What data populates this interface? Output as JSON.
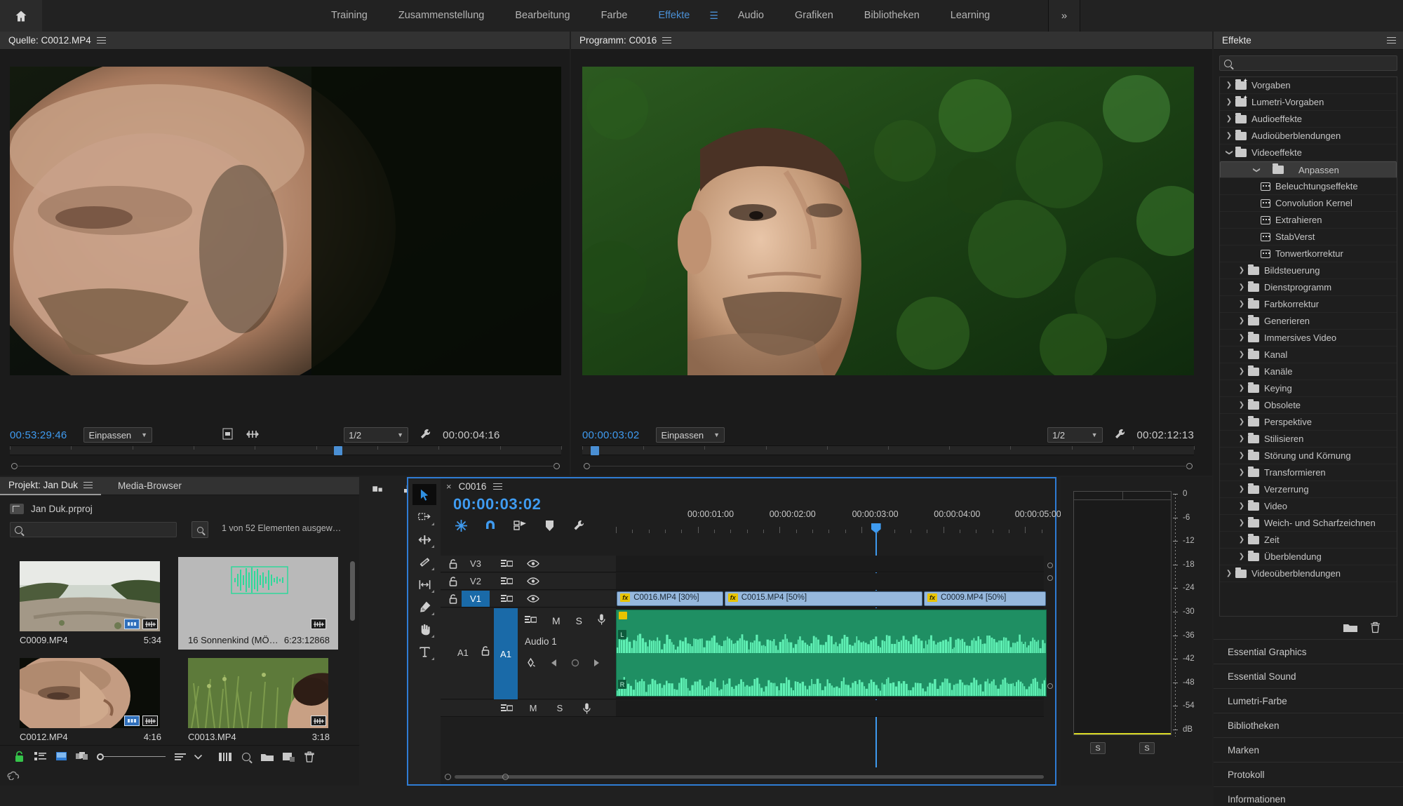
{
  "app": {
    "home_label": "home-icon",
    "overflow_label": "»"
  },
  "workspaces": [
    {
      "label": "Training",
      "active": false
    },
    {
      "label": "Zusammenstellung",
      "active": false
    },
    {
      "label": "Bearbeitung",
      "active": false
    },
    {
      "label": "Farbe",
      "active": false
    },
    {
      "label": "Effekte",
      "active": true
    },
    {
      "label": "Audio",
      "active": false
    },
    {
      "label": "Grafiken",
      "active": false
    },
    {
      "label": "Bibliotheken",
      "active": false
    },
    {
      "label": "Learning",
      "active": false
    }
  ],
  "source_monitor": {
    "tab_label": "Quelle: C0012.MP4",
    "current_time": "00:53:29:46",
    "fit_label": "Einpassen",
    "resolution_label": "1/2",
    "duration": "00:00:04:16",
    "playhead_pct": 59.5
  },
  "program_monitor": {
    "tab_label": "Programm: C0016",
    "current_time": "00:00:03:02",
    "fit_label": "Einpassen",
    "resolution_label": "1/2",
    "duration": "00:02:12:13",
    "playhead_pct": 1.4
  },
  "project_panel": {
    "tabs": [
      {
        "label": "Projekt: Jan Duk",
        "active": true
      },
      {
        "label": "Media-Browser",
        "active": false
      }
    ],
    "root_name": "Jan Duk.prproj",
    "search_placeholder": "",
    "search_value": "",
    "selection_status": "1 von 52 Elementen ausgew…",
    "items": [
      {
        "name": "C0009.MP4",
        "duration": "5:34",
        "selected": false,
        "type": "video",
        "badges": [
          "video-badge",
          "audio-badge"
        ]
      },
      {
        "name": "16 Sonnenkind (MÖ…",
        "duration": "6:23:12868",
        "selected": true,
        "type": "audio",
        "badges": [
          "audio-badge"
        ]
      },
      {
        "name": "C0012.MP4",
        "duration": "4:16",
        "selected": false,
        "type": "video",
        "badges": [
          "video-badge",
          "audio-badge"
        ]
      },
      {
        "name": "C0013.MP4",
        "duration": "3:18",
        "selected": false,
        "type": "video",
        "badges": [
          "audio-badge"
        ]
      }
    ],
    "bottom_icons": [
      "lock-icon",
      "list-view-icon",
      "icon-view-icon",
      "freeform-view-icon",
      "zoom-slider",
      "sort-icon",
      "chevron-down-icon",
      "multicam-icon",
      "find-icon",
      "new-bin-icon",
      "new-item-icon",
      "delete-icon"
    ]
  },
  "timeline": {
    "tab_label": "C0016",
    "current_time": "00:00:03:02",
    "ruler_labels": [
      "00:00:01:00",
      "00:00:02:00",
      "00:00:03:00",
      "00:00:04:00",
      "00:00:05:00"
    ],
    "ruler_positions_pct": [
      22.0,
      41.0,
      60.2,
      79.2,
      98.0
    ],
    "playhead_pct": 60.2,
    "header_icons": [
      "nest-icon",
      "snap-magnet-icon",
      "linked-selection-icon",
      "marker-icon",
      "wrench-icon"
    ],
    "tools": [
      "selection-tool",
      "track-select-tool",
      "ripple-edit-tool",
      "razor-tool",
      "slip-tool",
      "pen-tool",
      "hand-tool",
      "type-tool"
    ],
    "video_tracks": [
      {
        "name": "V3",
        "targeted": false
      },
      {
        "name": "V2",
        "targeted": false
      },
      {
        "name": "V1",
        "targeted": true
      }
    ],
    "audio_tracks": [
      {
        "name": "A1",
        "label": "Audio 1",
        "targeted": true,
        "source_patch": "A1"
      }
    ],
    "clips": [
      {
        "label": "C0016.MP4 [30%]",
        "left_pct": 0.2,
        "width_pct": 24.8,
        "fx": "fx"
      },
      {
        "label": "C0015.MP4 [50%]",
        "left_pct": 25.2,
        "width_pct": 46.0,
        "fx": "fx"
      },
      {
        "label": "C0009.MP4 [50%]",
        "left_pct": 71.5,
        "width_pct": 28.3,
        "fx": "fx"
      }
    ],
    "audio_clip": {
      "channel_top": "L",
      "channel_bottom": "R"
    }
  },
  "meters": {
    "scale_labels": [
      "0",
      "-6",
      "-12",
      "-18",
      "-24",
      "-30",
      "-36",
      "-42",
      "-48",
      "-54",
      "dB"
    ],
    "solo_buttons": [
      "S",
      "S"
    ]
  },
  "effects_panel": {
    "title": "Effekte",
    "search_placeholder": "",
    "search_value": "",
    "tree": [
      {
        "label": "Vorgaben",
        "depth": 0,
        "kind": "folder-star",
        "twirl": "closed",
        "selected": false
      },
      {
        "label": "Lumetri-Vorgaben",
        "depth": 0,
        "kind": "folder-star",
        "twirl": "closed",
        "selected": false
      },
      {
        "label": "Audioeffekte",
        "depth": 0,
        "kind": "folder",
        "twirl": "closed",
        "selected": false
      },
      {
        "label": "Audioüberblendungen",
        "depth": 0,
        "kind": "folder",
        "twirl": "closed",
        "selected": false
      },
      {
        "label": "Videoeffekte",
        "depth": 0,
        "kind": "folder",
        "twirl": "open",
        "selected": false
      },
      {
        "label": "Anpassen",
        "depth": 1,
        "kind": "folder",
        "twirl": "open",
        "selected": true
      },
      {
        "label": "Beleuchtungseffekte",
        "depth": 2,
        "kind": "effect",
        "twirl": "none",
        "selected": false
      },
      {
        "label": "Convolution Kernel",
        "depth": 2,
        "kind": "effect",
        "twirl": "none",
        "selected": false
      },
      {
        "label": "Extrahieren",
        "depth": 2,
        "kind": "effect",
        "twirl": "none",
        "selected": false
      },
      {
        "label": "StabVerst",
        "depth": 2,
        "kind": "effect",
        "twirl": "none",
        "selected": false
      },
      {
        "label": "Tonwertkorrektur",
        "depth": 2,
        "kind": "effect",
        "twirl": "none",
        "selected": false
      },
      {
        "label": "Bildsteuerung",
        "depth": 1,
        "kind": "folder",
        "twirl": "closed",
        "selected": false
      },
      {
        "label": "Dienstprogramm",
        "depth": 1,
        "kind": "folder",
        "twirl": "closed",
        "selected": false
      },
      {
        "label": "Farbkorrektur",
        "depth": 1,
        "kind": "folder",
        "twirl": "closed",
        "selected": false
      },
      {
        "label": "Generieren",
        "depth": 1,
        "kind": "folder",
        "twirl": "closed",
        "selected": false
      },
      {
        "label": "Immersives Video",
        "depth": 1,
        "kind": "folder",
        "twirl": "closed",
        "selected": false
      },
      {
        "label": "Kanal",
        "depth": 1,
        "kind": "folder",
        "twirl": "closed",
        "selected": false
      },
      {
        "label": "Kanäle",
        "depth": 1,
        "kind": "folder",
        "twirl": "closed",
        "selected": false
      },
      {
        "label": "Keying",
        "depth": 1,
        "kind": "folder",
        "twirl": "closed",
        "selected": false
      },
      {
        "label": "Obsolete",
        "depth": 1,
        "kind": "folder",
        "twirl": "closed",
        "selected": false
      },
      {
        "label": "Perspektive",
        "depth": 1,
        "kind": "folder",
        "twirl": "closed",
        "selected": false
      },
      {
        "label": "Stilisieren",
        "depth": 1,
        "kind": "folder",
        "twirl": "closed",
        "selected": false
      },
      {
        "label": "Störung und Körnung",
        "depth": 1,
        "kind": "folder",
        "twirl": "closed",
        "selected": false
      },
      {
        "label": "Transformieren",
        "depth": 1,
        "kind": "folder",
        "twirl": "closed",
        "selected": false
      },
      {
        "label": "Verzerrung",
        "depth": 1,
        "kind": "folder",
        "twirl": "closed",
        "selected": false
      },
      {
        "label": "Video",
        "depth": 1,
        "kind": "folder",
        "twirl": "closed",
        "selected": false
      },
      {
        "label": "Weich- und Scharfzeichnen",
        "depth": 1,
        "kind": "folder",
        "twirl": "closed",
        "selected": false
      },
      {
        "label": "Zeit",
        "depth": 1,
        "kind": "folder",
        "twirl": "closed",
        "selected": false
      },
      {
        "label": "Überblendung",
        "depth": 1,
        "kind": "folder",
        "twirl": "closed",
        "selected": false
      },
      {
        "label": "Videoüberblendungen",
        "depth": 0,
        "kind": "folder",
        "twirl": "closed",
        "selected": false
      }
    ],
    "stacked_panels": [
      "Essential Graphics",
      "Essential Sound",
      "Lumetri-Farbe",
      "Bibliotheken",
      "Marken",
      "Protokoll",
      "Informationen"
    ]
  },
  "colors": {
    "accent_blue": "#3f9bf0",
    "timeline_border": "#2f7cd4",
    "clip_blue": "#96b8dd",
    "audio_green": "#1f8f63",
    "fx_yellow": "#e8c400",
    "meter_yellow": "#d8d825"
  }
}
